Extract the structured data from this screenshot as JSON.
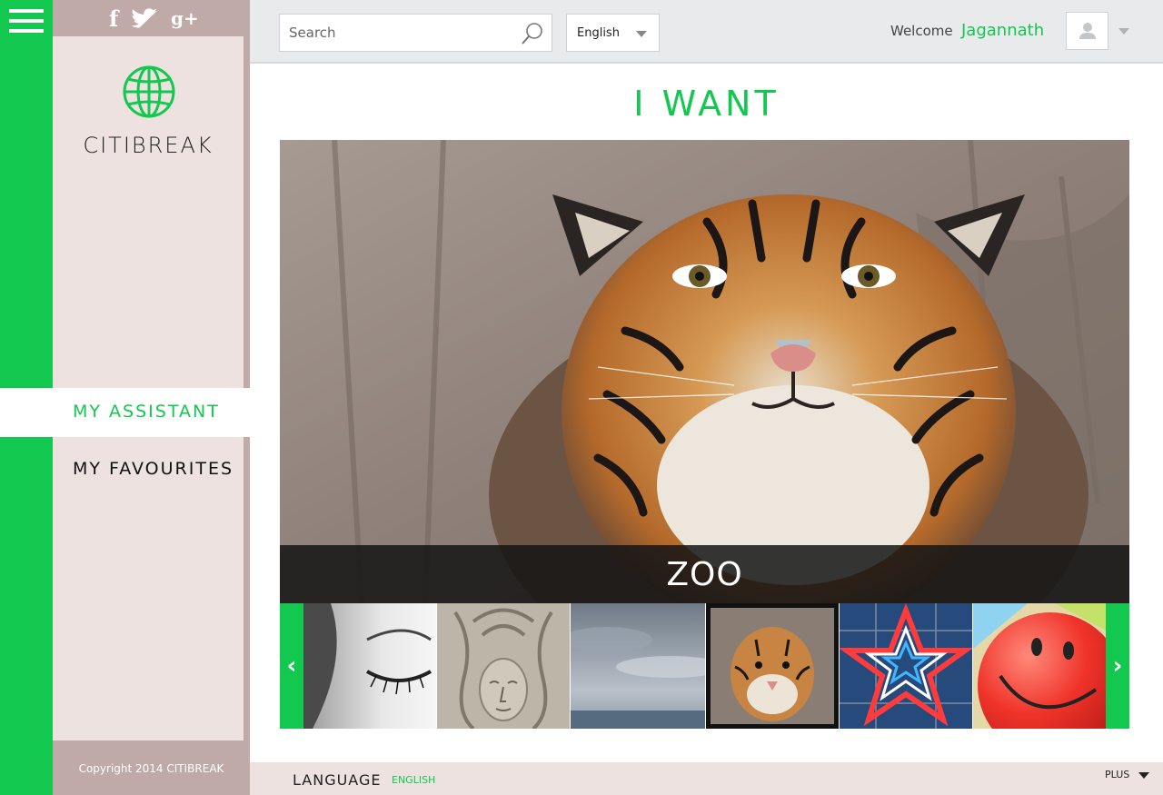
{
  "social": {
    "facebook_label": "f",
    "twitter_icon": "twitter-icon",
    "google_plus_label": "g+"
  },
  "brand": {
    "logo_icon": "globe-icon",
    "name": "CITIBREAK",
    "color": "#12c84f"
  },
  "nav": {
    "items": [
      {
        "label": "MY  ASSISTANT",
        "active": true
      },
      {
        "label": "MY  FAVOURITES",
        "active": false
      }
    ]
  },
  "copyright": "Copyright  2014   CITIBREAK",
  "header": {
    "search_placeholder": "Search",
    "language": "English",
    "welcome_label": "Welcome",
    "username": "Jagannath"
  },
  "main": {
    "title": "I  WANT",
    "hero_caption": "ZOO",
    "thumbnails": [
      {
        "subject": "closed eye",
        "selected": false
      },
      {
        "subject": "stone carving face",
        "selected": false
      },
      {
        "subject": "cloudy sky",
        "selected": false
      },
      {
        "subject": "tiger",
        "selected": true
      },
      {
        "subject": "neon star",
        "selected": false
      },
      {
        "subject": "smiley balloon",
        "selected": false
      }
    ]
  },
  "footer": {
    "language_label": "LANGUAGE",
    "language_value": "ENGLISH",
    "plus_label": "PLUS"
  }
}
